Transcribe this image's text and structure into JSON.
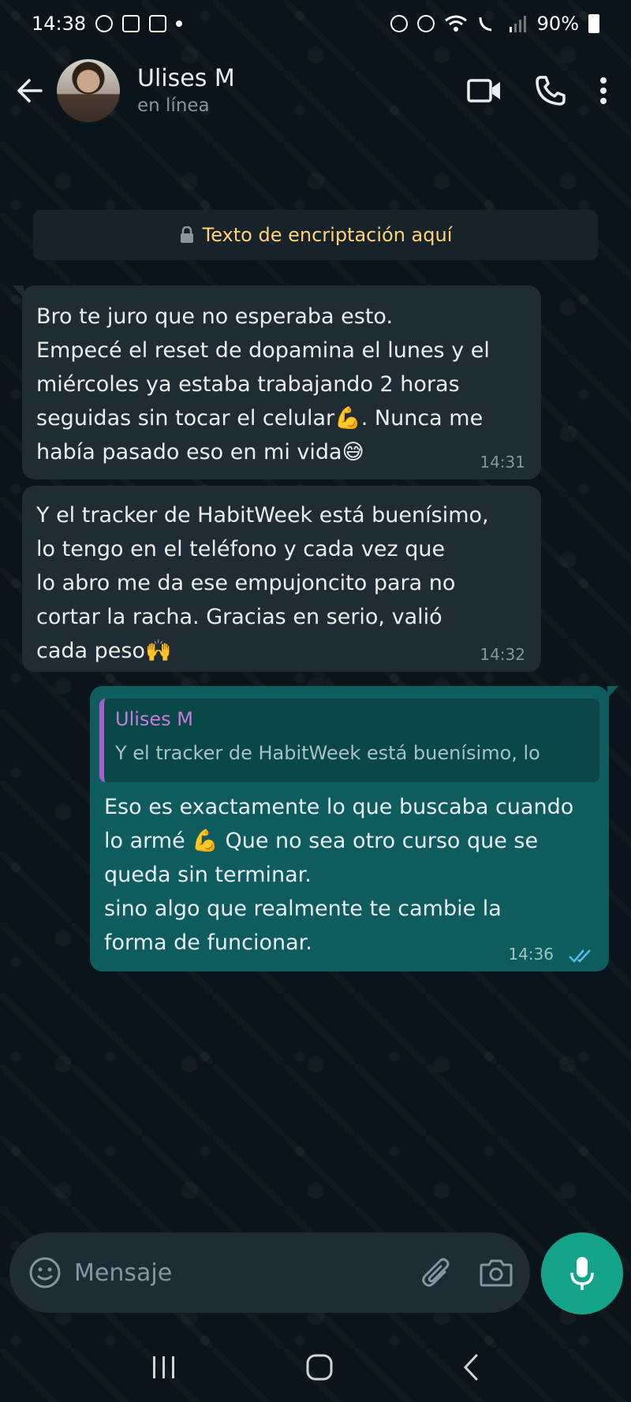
{
  "status_bar": {
    "time": "14:38",
    "battery": "90%"
  },
  "header": {
    "contact_name": "Ulises M",
    "contact_status": "en línea"
  },
  "encryption_notice": "Texto de encriptación aquí",
  "messages": [
    {
      "direction": "incoming",
      "text": "Bro te juro que no esperaba esto.\nEmpecé el reset de dopamina el lunes y el\nmiércoles ya estaba trabajando 2 horas\nseguidas sin tocar el celular💪. Nunca me\nhabía pasado eso en mi vida😅",
      "time": "14:31"
    },
    {
      "direction": "incoming",
      "text": "Y el tracker de HabitWeek está buenísimo,\nlo tengo en el teléfono y cada vez que\nlo abro me da ese empujoncito para no\ncortar la racha. Gracias en serio, valió\ncada peso🙌",
      "time": "14:32"
    },
    {
      "direction": "outgoing",
      "quote_author": "Ulises M",
      "quote_text": "Y el tracker de HabitWeek está buenísimo, lo",
      "text": "Eso es exactamente lo que buscaba cuando\nlo armé 💪 Que no sea otro curso que se\nqueda sin terminar.\nsino algo que realmente te cambie la\nforma de funcionar.",
      "time": "14:36",
      "read": true
    }
  ],
  "input": {
    "placeholder": "Mensaje"
  },
  "colors": {
    "background": "#0b141a",
    "incoming_bubble": "#202c33",
    "outgoing_bubble": "#0e5c5e",
    "accent": "#15a38a",
    "encryption_text": "#ffd279",
    "read_ticks": "#53bdeb"
  },
  "icons": {
    "back": "arrow-left-icon",
    "video_call": "video-camera-icon",
    "voice_call": "phone-icon",
    "menu": "more-vertical-icon",
    "lock": "lock-icon",
    "emoji": "emoji-icon",
    "attach": "paperclip-icon",
    "camera": "camera-icon",
    "mic": "microphone-icon"
  }
}
